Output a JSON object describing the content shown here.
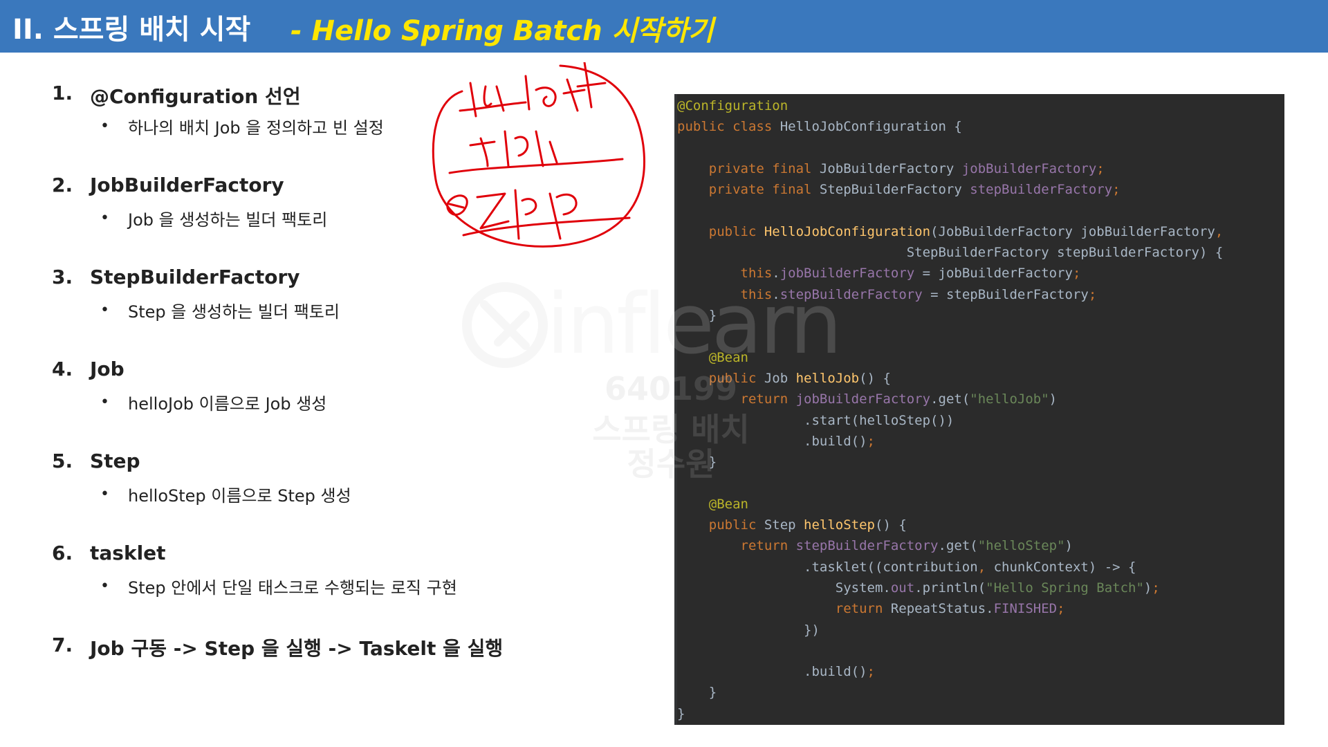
{
  "header": {
    "title": "II. 스프링 배치 시작",
    "subtitle": "- Hello Spring Batch 시작하기"
  },
  "items": [
    {
      "num": "1.",
      "title": "@Configuration 선언",
      "desc": "하나의 배치 Job 을 정의하고 빈 설정"
    },
    {
      "num": "2.",
      "title": "JobBuilderFactory",
      "desc": "Job 을 생성하는 빌더 팩토리"
    },
    {
      "num": "3.",
      "title": "StepBuilderFactory",
      "desc": "Step 을 생성하는 빌더 팩토리"
    },
    {
      "num": "4.",
      "title": "Job",
      "desc": "helloJob 이름으로 Job 생성"
    },
    {
      "num": "5.",
      "title": "Step",
      "desc": "helloStep 이름으로 Step 생성"
    },
    {
      "num": "6.",
      "title": "tasklet",
      "desc": "Step 안에서 단일 태스크로 수행되는 로직 구현"
    },
    {
      "num": "7.",
      "title": "Job 구동 -> Step 을 실행 -> Taskelt 을 실행",
      "desc": ""
    }
  ],
  "code_lines": [
    [
      {
        "t": "@Configuration",
        "c": "#bbb529"
      }
    ],
    [
      {
        "t": "public class ",
        "c": "#cc7832"
      },
      {
        "t": "HelloJobConfiguration {",
        "c": "#a9b7c6"
      }
    ],
    [],
    [
      {
        "t": "    private final ",
        "c": "#cc7832"
      },
      {
        "t": "JobBuilderFactory ",
        "c": "#a9b7c6"
      },
      {
        "t": "jobBuilderFactory",
        "c": "#9876aa"
      },
      {
        "t": ";",
        "c": "#cc7832"
      }
    ],
    [
      {
        "t": "    private final ",
        "c": "#cc7832"
      },
      {
        "t": "StepBuilderFactory ",
        "c": "#a9b7c6"
      },
      {
        "t": "stepBuilderFactory",
        "c": "#9876aa"
      },
      {
        "t": ";",
        "c": "#cc7832"
      }
    ],
    [],
    [
      {
        "t": "    public ",
        "c": "#cc7832"
      },
      {
        "t": "HelloJobConfiguration",
        "c": "#ffc66d"
      },
      {
        "t": "(JobBuilderFactory jobBuilderFactory",
        "c": "#a9b7c6"
      },
      {
        "t": ",",
        "c": "#cc7832"
      }
    ],
    [
      {
        "t": "                             StepBuilderFactory stepBuilderFactory) {",
        "c": "#a9b7c6"
      }
    ],
    [
      {
        "t": "        this",
        "c": "#cc7832"
      },
      {
        "t": ".",
        "c": "#a9b7c6"
      },
      {
        "t": "jobBuilderFactory",
        "c": "#9876aa"
      },
      {
        "t": " = jobBuilderFactory",
        "c": "#a9b7c6"
      },
      {
        "t": ";",
        "c": "#cc7832"
      }
    ],
    [
      {
        "t": "        this",
        "c": "#cc7832"
      },
      {
        "t": ".",
        "c": "#a9b7c6"
      },
      {
        "t": "stepBuilderFactory",
        "c": "#9876aa"
      },
      {
        "t": " = stepBuilderFactory",
        "c": "#a9b7c6"
      },
      {
        "t": ";",
        "c": "#cc7832"
      }
    ],
    [
      {
        "t": "    }",
        "c": "#a9b7c6"
      }
    ],
    [],
    [
      {
        "t": "    @Bean",
        "c": "#bbb529"
      }
    ],
    [
      {
        "t": "    public ",
        "c": "#cc7832"
      },
      {
        "t": "Job ",
        "c": "#a9b7c6"
      },
      {
        "t": "helloJob",
        "c": "#ffc66d"
      },
      {
        "t": "() {",
        "c": "#a9b7c6"
      }
    ],
    [
      {
        "t": "        return ",
        "c": "#cc7832"
      },
      {
        "t": "jobBuilderFactory",
        "c": "#9876aa"
      },
      {
        "t": ".get(",
        "c": "#a9b7c6"
      },
      {
        "t": "\"helloJob\"",
        "c": "#6a8759"
      },
      {
        "t": ")",
        "c": "#a9b7c6"
      }
    ],
    [
      {
        "t": "                .start(helloStep())",
        "c": "#a9b7c6"
      }
    ],
    [
      {
        "t": "                .build()",
        "c": "#a9b7c6"
      },
      {
        "t": ";",
        "c": "#cc7832"
      }
    ],
    [
      {
        "t": "    }",
        "c": "#a9b7c6"
      }
    ],
    [],
    [
      {
        "t": "    @Bean",
        "c": "#bbb529"
      }
    ],
    [
      {
        "t": "    public ",
        "c": "#cc7832"
      },
      {
        "t": "Step ",
        "c": "#a9b7c6"
      },
      {
        "t": "helloStep",
        "c": "#ffc66d"
      },
      {
        "t": "() {",
        "c": "#a9b7c6"
      }
    ],
    [
      {
        "t": "        return ",
        "c": "#cc7832"
      },
      {
        "t": "stepBuilderFactory",
        "c": "#9876aa"
      },
      {
        "t": ".get(",
        "c": "#a9b7c6"
      },
      {
        "t": "\"helloStep\"",
        "c": "#6a8759"
      },
      {
        "t": ")",
        "c": "#a9b7c6"
      }
    ],
    [
      {
        "t": "                .tasklet((contribution",
        "c": "#a9b7c6"
      },
      {
        "t": ", ",
        "c": "#cc7832"
      },
      {
        "t": "chunkContext) -> {",
        "c": "#a9b7c6"
      }
    ],
    [
      {
        "t": "                    System.",
        "c": "#a9b7c6"
      },
      {
        "t": "out",
        "c": "#9876aa"
      },
      {
        "t": ".println(",
        "c": "#a9b7c6"
      },
      {
        "t": "\"Hello Spring Batch\"",
        "c": "#6a8759"
      },
      {
        "t": ")",
        "c": "#a9b7c6"
      },
      {
        "t": ";",
        "c": "#cc7832"
      }
    ],
    [
      {
        "t": "                    return ",
        "c": "#cc7832"
      },
      {
        "t": "RepeatStatus.",
        "c": "#a9b7c6"
      },
      {
        "t": "FINISHED",
        "c": "#9876aa"
      },
      {
        "t": ";",
        "c": "#cc7832"
      }
    ],
    [
      {
        "t": "                })",
        "c": "#a9b7c6"
      }
    ],
    [],
    [
      {
        "t": "                .build()",
        "c": "#a9b7c6"
      },
      {
        "t": ";",
        "c": "#cc7832"
      }
    ],
    [
      {
        "t": "    }",
        "c": "#a9b7c6"
      }
    ],
    [
      {
        "t": "}",
        "c": "#a9b7c6"
      }
    ]
  ],
  "watermark": {
    "brand": "inflearn",
    "id": "640199",
    "course": "스프링 배치",
    "author": "정수원"
  },
  "colors": {
    "header_bg": "#3a78bd",
    "header_subtitle": "#ffe600",
    "code_bg": "#2b2b2b",
    "annotation": "#e0000a"
  }
}
